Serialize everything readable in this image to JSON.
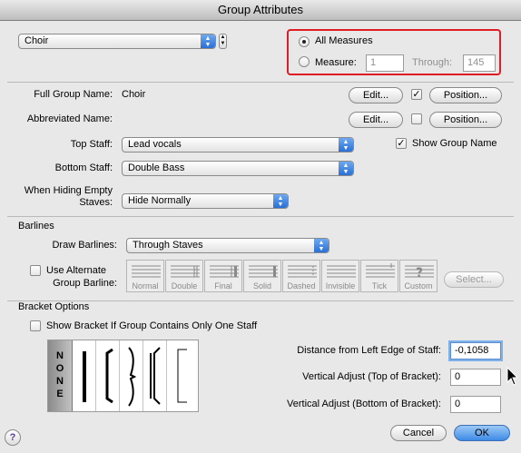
{
  "window": {
    "title": "Group Attributes"
  },
  "group_select": {
    "value": "Choir"
  },
  "measures": {
    "all_label": "All Measures",
    "measure_label": "Measure:",
    "from_value": "1",
    "through_label": "Through:",
    "through_value": "145",
    "highlight_color": "#e01c24"
  },
  "names": {
    "full_label": "Full Group Name:",
    "full_value": "Choir",
    "abbr_label": "Abbreviated Name:",
    "edit_label": "Edit...",
    "position_label": "Position..."
  },
  "staves": {
    "top_label": "Top Staff:",
    "top_value": "Lead vocals",
    "bottom_label": "Bottom Staff:",
    "bottom_value": "Double Bass",
    "show_group_name": "Show Group Name",
    "hiding_label_1": "When Hiding Empty",
    "hiding_label_2": "Staves:",
    "hiding_value": "Hide Normally"
  },
  "barlines": {
    "section": "Barlines",
    "draw_label": "Draw Barlines:",
    "draw_value": "Through Staves",
    "alternate_1": "Use Alternate",
    "alternate_2": "Group Barline:",
    "styles": [
      "Normal",
      "Double",
      "Final",
      "Solid",
      "Dashed",
      "Invisible",
      "Tick",
      "Custom"
    ],
    "select_label": "Select..."
  },
  "brackets": {
    "section": "Bracket Options",
    "show_one_staff": "Show Bracket If Group Contains Only One Staff",
    "none_letters": [
      "N",
      "O",
      "N",
      "E"
    ],
    "distance_label": "Distance from Left Edge of Staff:",
    "distance_value": "-0,1058",
    "top_label": "Vertical Adjust (Top of Bracket):",
    "top_value": "0",
    "bottom_label": "Vertical Adjust (Bottom of Bracket):",
    "bottom_value": "0"
  },
  "footer": {
    "cancel": "Cancel",
    "ok": "OK",
    "help": "?"
  }
}
